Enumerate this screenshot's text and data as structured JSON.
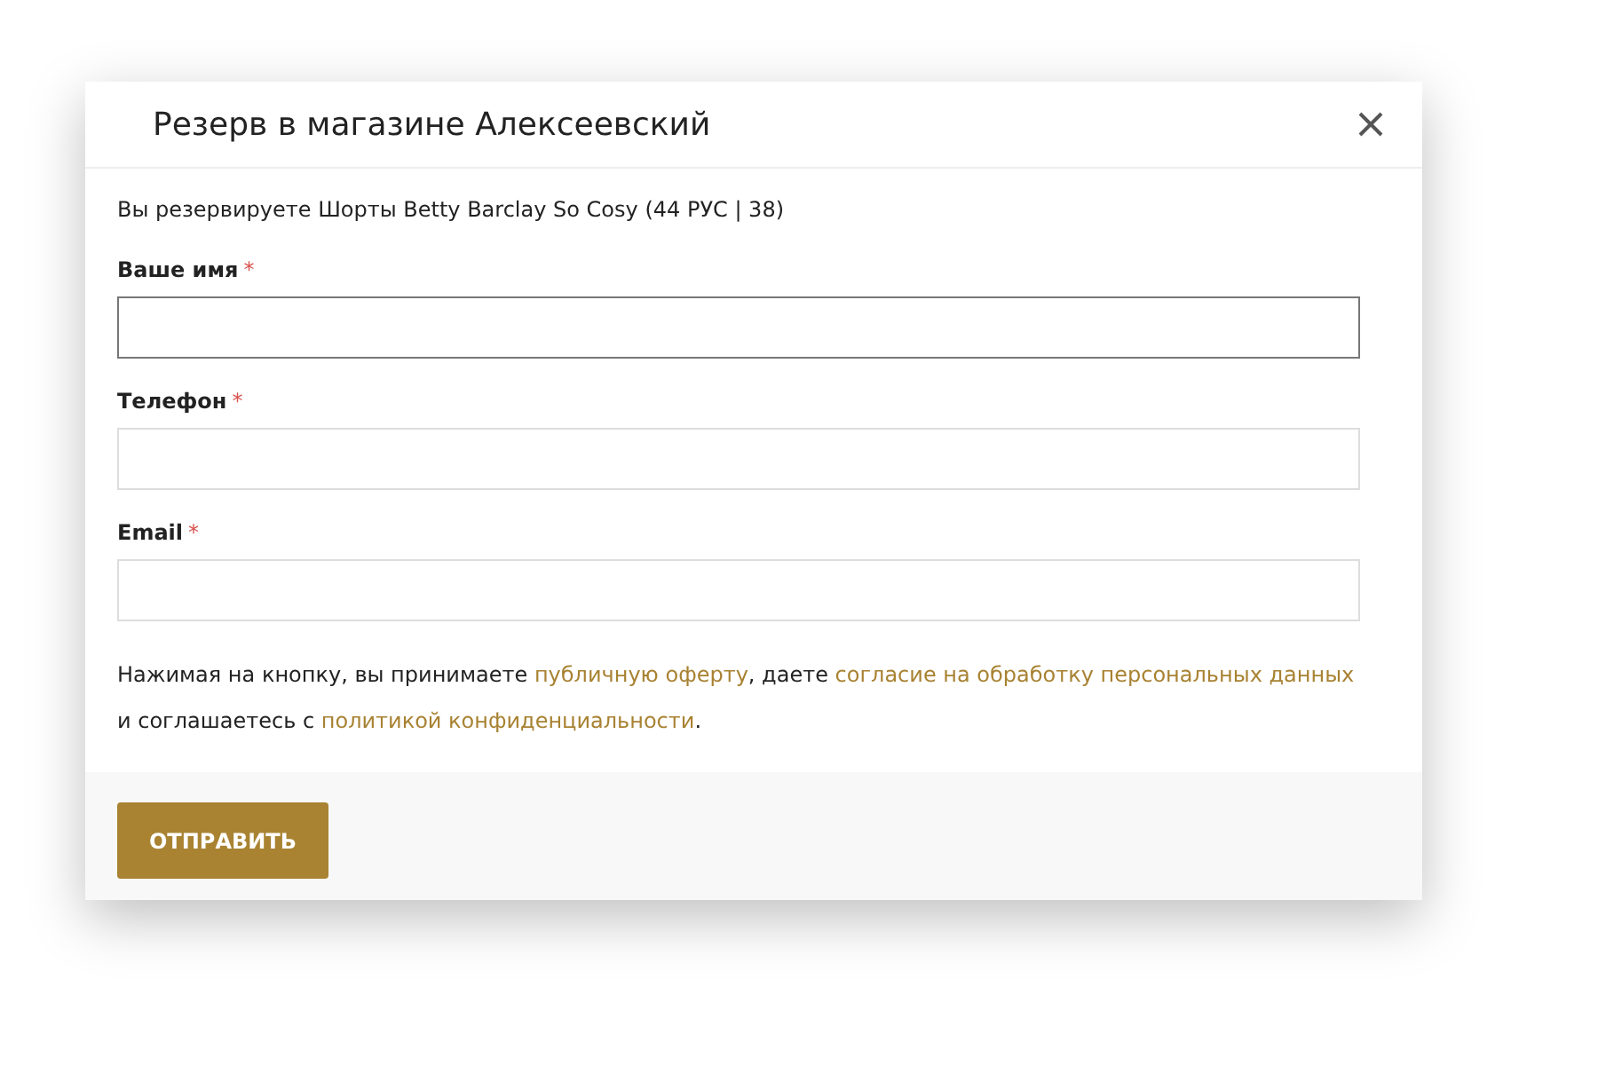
{
  "dialog": {
    "title": "Резерв в магазине Алексеевский",
    "intro": "Вы резервируете Шорты Betty Barclay So Cosy (44 РУС | 38)",
    "fields": [
      {
        "label": "Ваше имя",
        "required_mark": "*",
        "focused": true
      },
      {
        "label": "Телефон",
        "required_mark": "*",
        "focused": false
      },
      {
        "label": "Email",
        "required_mark": "*",
        "focused": false
      }
    ],
    "consent": [
      {
        "kind": "text",
        "text": "Нажимая на кнопку, вы принимаете "
      },
      {
        "kind": "link",
        "text": "публичную оферту"
      },
      {
        "kind": "text",
        "text": ", даете "
      },
      {
        "kind": "link",
        "text": "согласие на обработку персональных данных"
      },
      {
        "kind": "text",
        "text": " и соглашаетесь с "
      },
      {
        "kind": "link",
        "text": "политикой конфиденциальности"
      },
      {
        "kind": "text",
        "text": "."
      }
    ],
    "submit": "ОТПРАВИТЬ"
  }
}
